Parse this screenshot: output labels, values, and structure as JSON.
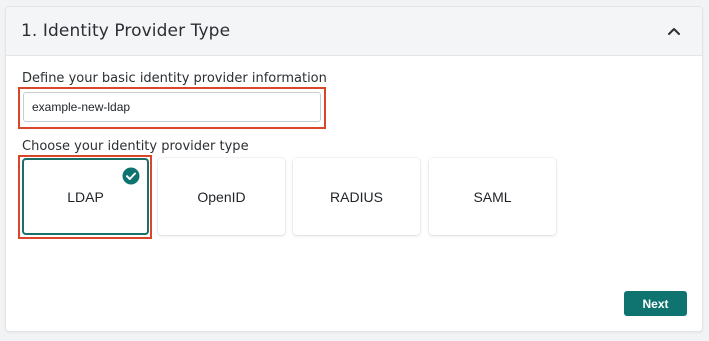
{
  "section": {
    "title": "1. Identity Provider Type",
    "collapse_icon": "chevron-up-icon"
  },
  "basic_info": {
    "label": "Define your basic identity provider information",
    "name_value": "example-new-ldap"
  },
  "provider_type": {
    "label": "Choose your identity provider type",
    "options": [
      {
        "label": "LDAP",
        "selected": true
      },
      {
        "label": "OpenID",
        "selected": false
      },
      {
        "label": "RADIUS",
        "selected": false
      },
      {
        "label": "SAML",
        "selected": false
      }
    ],
    "selected_icon": "check-circle-icon"
  },
  "actions": {
    "next_label": "Next"
  },
  "colors": {
    "accent": "#0f7370",
    "highlight": "#d9462b"
  }
}
